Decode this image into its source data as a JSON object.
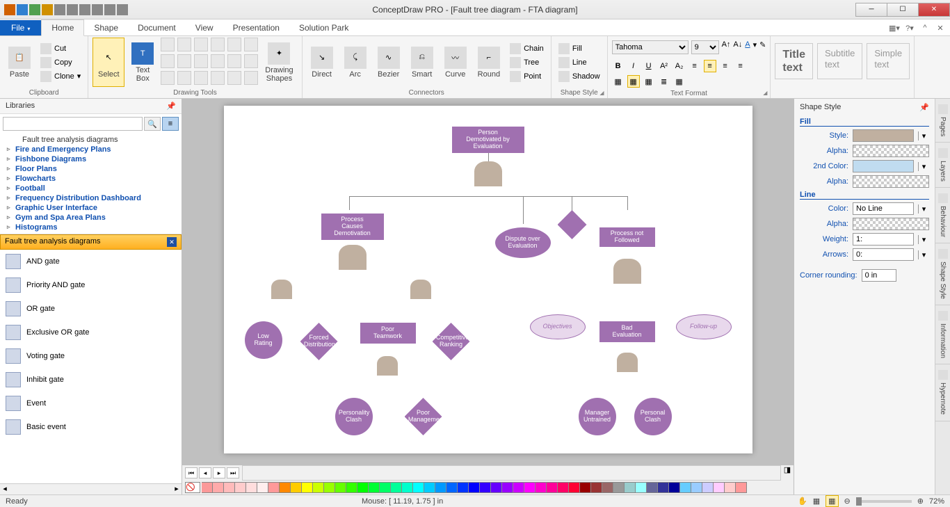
{
  "title": "ConceptDraw PRO - [Fault tree diagram - FTA diagram]",
  "tabs": {
    "file": "File",
    "home": "Home",
    "shape": "Shape",
    "document": "Document",
    "view": "View",
    "presentation": "Presentation",
    "solutionpark": "Solution Park"
  },
  "ribbon": {
    "paste": "Paste",
    "cut": "Cut",
    "copy": "Copy",
    "clone": "Clone",
    "clipboard": "Clipboard",
    "select": "Select",
    "textbox": "Text\nBox",
    "drawingshapes": "Drawing\nShapes",
    "drawingtools": "Drawing Tools",
    "direct": "Direct",
    "arc": "Arc",
    "bezier": "Bezier",
    "smart": "Smart",
    "curve": "Curve",
    "round": "Round",
    "connectors": "Connectors",
    "chain": "Chain",
    "tree": "Tree",
    "point": "Point",
    "fill": "Fill",
    "line": "Line",
    "shadow": "Shadow",
    "shapestyle": "Shape Style",
    "fontname": "Tahoma",
    "fontsize": "9",
    "textformat": "Text Format",
    "titletext": "Title\ntext",
    "subtitletext": "Subtitle\ntext",
    "simpletext": "Simple\ntext"
  },
  "left": {
    "libraries": "Libraries",
    "tree": [
      "Fault tree analysis diagrams",
      "Fire and Emergency Plans",
      "Fishbone Diagrams",
      "Floor Plans",
      "Flowcharts",
      "Football",
      "Frequency Distribution Dashboard",
      "Graphic User Interface",
      "Gym and Spa Area Plans",
      "Histograms"
    ],
    "shapes_hdr": "Fault tree analysis diagrams",
    "shapes": [
      "AND gate",
      "Priority AND gate",
      "OR gate",
      "Exclusive OR gate",
      "Voting gate",
      "Inhibit gate",
      "Event",
      "Basic event"
    ]
  },
  "right": {
    "hdr": "Shape Style",
    "fill": "Fill",
    "style": "Style:",
    "alpha": "Alpha:",
    "color2": "2nd Color:",
    "linesec": "Line",
    "color": "Color:",
    "noline": "No Line",
    "weight": "Weight:",
    "weightval": "1:",
    "arrows": "Arrows:",
    "arrowsval": "0:",
    "corner": "Corner rounding:",
    "cornerval": "0 in",
    "tabs": [
      "Pages",
      "Layers",
      "Behaviour",
      "Shape Style",
      "Information",
      "Hypernote"
    ]
  },
  "fta": {
    "top": "Person Demotivated by Evaluation",
    "l1": "Process Causes Demotivation",
    "l1b": "Dispute over Evaluation",
    "l1c": "Process not Followed",
    "l2a": "Low Rating",
    "l2b": "Forced Distribution",
    "l2c": "Poor Teamwork",
    "l2d": "Competitive Ranking",
    "l2e": "Objectives",
    "l2f": "Bad Evaluation",
    "l2g": "Follow-up",
    "l3a": "Personality Clash",
    "l3b": "Poor Management",
    "l3c": "Manager Untrained",
    "l3d": "Personal Clash"
  },
  "status": {
    "ready": "Ready",
    "mouse": "Mouse: [ 11.19, 1.75 ] in",
    "zoom": "72%"
  },
  "palette": [
    "#fb9999",
    "#faa",
    "#fbb",
    "#fcc",
    "#fdd",
    "#fee",
    "#ff9999",
    "#f80",
    "#fc0",
    "#ff0",
    "#cf0",
    "#9f0",
    "#6f0",
    "#3f0",
    "#0f0",
    "#0f3",
    "#0f6",
    "#0f9",
    "#0fc",
    "#0ff",
    "#0cf",
    "#09f",
    "#06f",
    "#03f",
    "#00f",
    "#30f",
    "#60f",
    "#90f",
    "#c0f",
    "#f0f",
    "#f0c",
    "#f09",
    "#f06",
    "#f03",
    "#900",
    "#933",
    "#966",
    "#999",
    "#9cc",
    "#9ff",
    "#669",
    "#339",
    "#009",
    "#6cf",
    "#9cf",
    "#ccf",
    "#fcf",
    "#fcc",
    "#f99"
  ]
}
